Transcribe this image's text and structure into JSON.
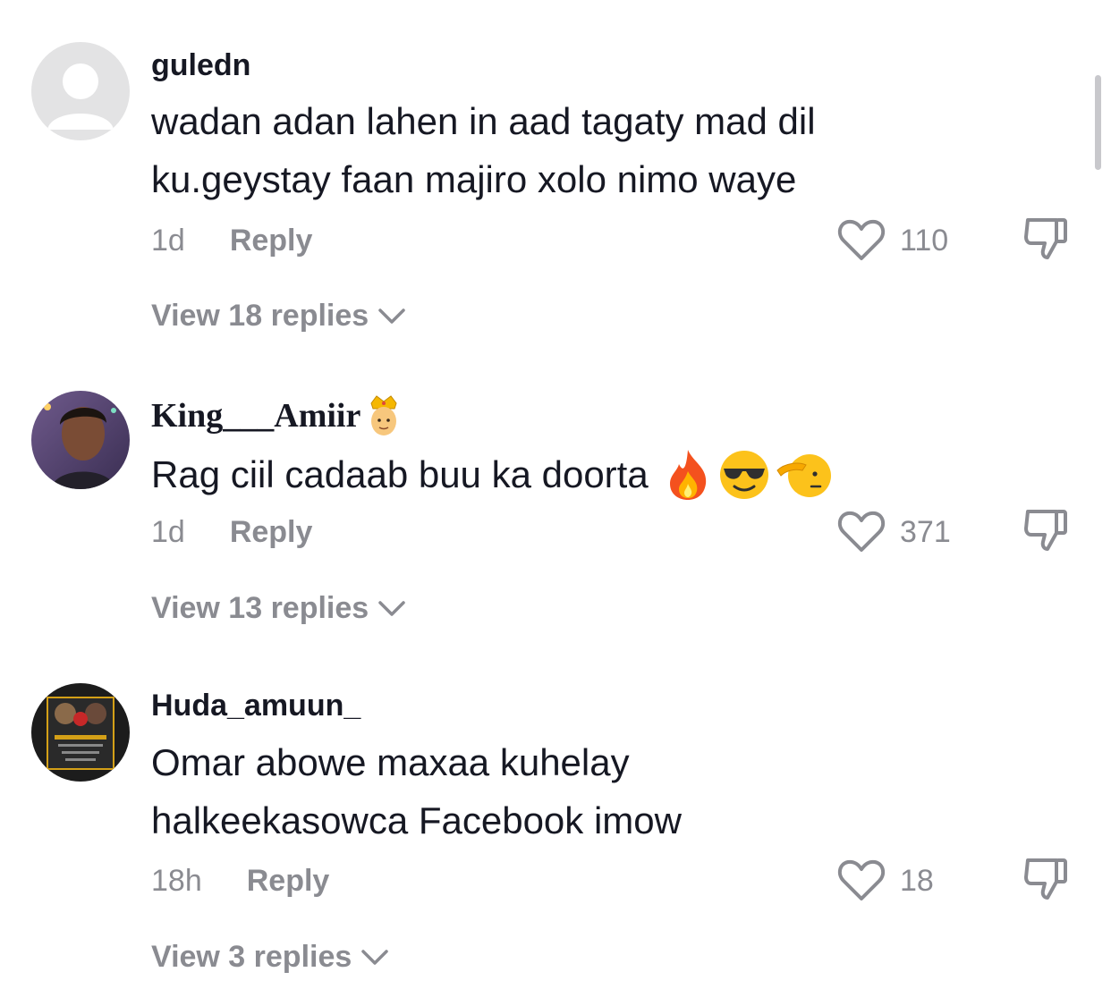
{
  "comments": [
    {
      "username": "guledn",
      "text": "wadan adan lahen in aad tagaty mad dil\nku.geystay faan majiro xolo nimo waye",
      "time": "1d",
      "reply_label": "Reply",
      "likes": "110",
      "view_replies": "View 18 replies",
      "avatar": "default-avatar-icon"
    },
    {
      "username": "King___Amiir",
      "text": "Rag ciil cadaab buu ka doorta",
      "emojis": [
        "prince-emoji",
        "fire-emoji",
        "sunglasses-emoji",
        "saluting-face-emoji"
      ],
      "time": "1d",
      "reply_label": "Reply",
      "likes": "371",
      "view_replies": "View 13 replies",
      "avatar": "user-photo"
    },
    {
      "username": "Huda_amuun_",
      "text": "Omar abowe maxaa kuhelay\nhalkeekasowca Facebook imow",
      "time": "18h",
      "reply_label": "Reply",
      "likes": "18",
      "view_replies": "View 3 replies",
      "avatar": "poster-photo"
    }
  ],
  "colors": {
    "text": "#161823",
    "muted": "#8a8b91",
    "background": "#ffffff"
  }
}
